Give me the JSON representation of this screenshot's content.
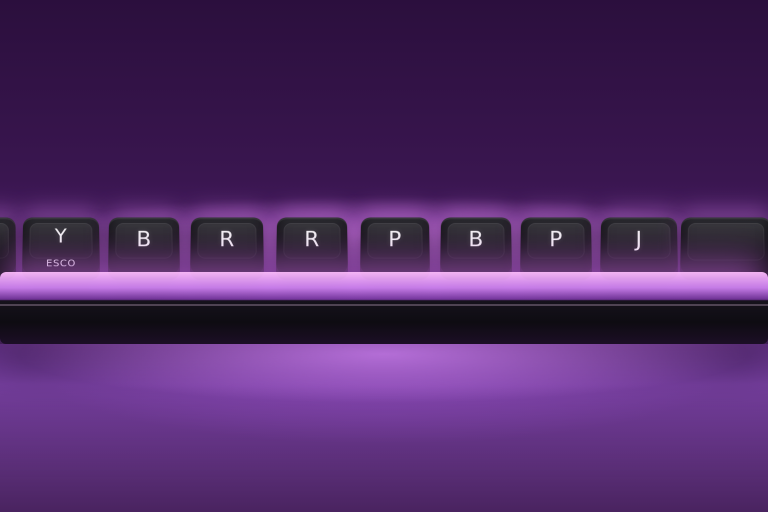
{
  "keyboard": {
    "keys": [
      {
        "legend": ""
      },
      {
        "legend": "Y",
        "sublabel": "ESCO"
      },
      {
        "legend": "B"
      },
      {
        "legend": "R"
      },
      {
        "legend": "R"
      },
      {
        "legend": "P"
      },
      {
        "legend": "B"
      },
      {
        "legend": "P"
      },
      {
        "legend": "J"
      },
      {
        "legend": ""
      }
    ]
  }
}
